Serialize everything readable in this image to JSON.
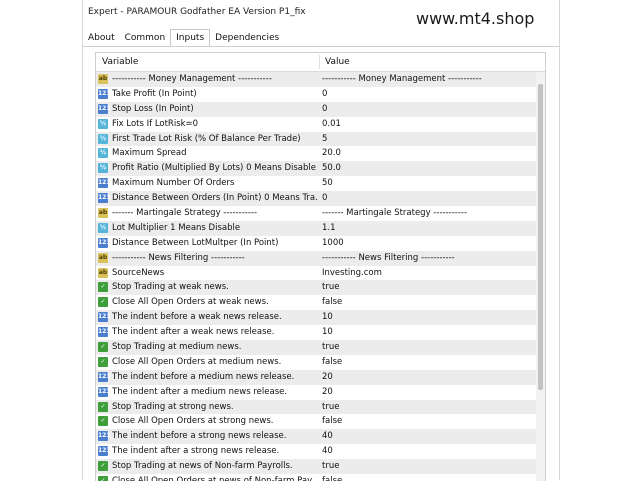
{
  "window": {
    "title": "Expert - PARAMOUR Godfather EA Version P1_fix"
  },
  "watermark": "www.mt4.shop",
  "tabs": [
    {
      "label": "About"
    },
    {
      "label": "Common"
    },
    {
      "label": "Inputs",
      "active": true
    },
    {
      "label": "Dependencies"
    }
  ],
  "table": {
    "headers": {
      "variable": "Variable",
      "value": "Value"
    },
    "rows": [
      {
        "icon": "ab",
        "name": "----------- Money Management -----------",
        "value": "----------- Money Management -----------"
      },
      {
        "icon": "num",
        "name": "Take Profit (In Point)",
        "value": "0"
      },
      {
        "icon": "num",
        "name": "Stop Loss (In Point)",
        "value": "0"
      },
      {
        "icon": "dbl",
        "name": "Fix Lots If LotRisk=0",
        "value": "0.01"
      },
      {
        "icon": "dbl",
        "name": "First Trade Lot Risk (% Of Balance Per Trade)",
        "value": "5"
      },
      {
        "icon": "dbl",
        "name": "Maximum Spread",
        "value": "20.0"
      },
      {
        "icon": "dbl",
        "name": "Profit Ratio (Multiplied By Lots) 0 Means Disable",
        "value": "50.0"
      },
      {
        "icon": "num",
        "name": "Maximum Number Of Orders",
        "value": "50"
      },
      {
        "icon": "num",
        "name": "Distance Between Orders (In Point) 0 Means Tra...",
        "value": "0"
      },
      {
        "icon": "ab",
        "name": "------- Martingale Strategy -----------",
        "value": "------- Martingale Strategy -----------"
      },
      {
        "icon": "dbl",
        "name": "Lot Multiplier 1 Means Disable",
        "value": "1.1"
      },
      {
        "icon": "num",
        "name": "Distance Between LotMultper (In Point)",
        "value": "1000"
      },
      {
        "icon": "ab",
        "name": "----------- News Filtering -----------",
        "value": "----------- News Filtering -----------"
      },
      {
        "icon": "ab",
        "name": "SourceNews",
        "value": "Investing.com"
      },
      {
        "icon": "bool",
        "name": "Stop Trading at weak news.",
        "value": "true"
      },
      {
        "icon": "bool",
        "name": "Close All Open Orders at weak news.",
        "value": "false"
      },
      {
        "icon": "num",
        "name": "The indent before a weak news release.",
        "value": "10"
      },
      {
        "icon": "num",
        "name": "The indent after a weak news release.",
        "value": "10"
      },
      {
        "icon": "bool",
        "name": "Stop Trading at medium news.",
        "value": "true"
      },
      {
        "icon": "bool",
        "name": "Close All Open Orders at medium news.",
        "value": "false"
      },
      {
        "icon": "num",
        "name": "The indent before a medium news release.",
        "value": "20"
      },
      {
        "icon": "num",
        "name": "The indent after a medium news release.",
        "value": "20"
      },
      {
        "icon": "bool",
        "name": "Stop Trading at strong news.",
        "value": "true"
      },
      {
        "icon": "bool",
        "name": "Close All Open Orders at strong news.",
        "value": "false"
      },
      {
        "icon": "num",
        "name": "The indent before a strong news release.",
        "value": "40"
      },
      {
        "icon": "num",
        "name": "The indent after a strong news release.",
        "value": "40"
      },
      {
        "icon": "bool",
        "name": "Stop Trading at news of Non-farm Payrolls.",
        "value": "true"
      },
      {
        "icon": "bool",
        "name": "Close All Open Orders at news of Non-farm Pay...",
        "value": "false"
      }
    ]
  }
}
